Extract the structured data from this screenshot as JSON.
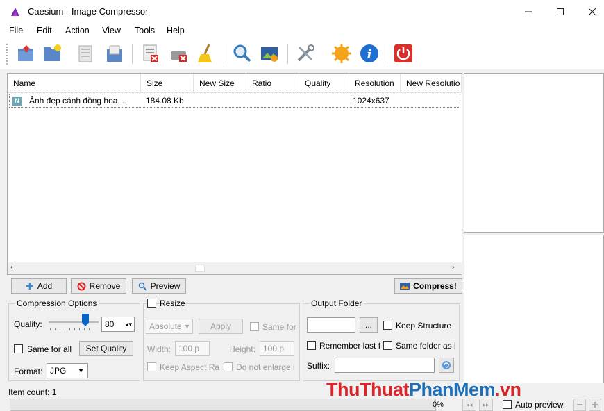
{
  "window": {
    "title": "Caesium - Image Compressor"
  },
  "menu": [
    "File",
    "Edit",
    "Action",
    "View",
    "Tools",
    "Help"
  ],
  "toolbar_icons": [
    "open-file-icon",
    "open-folder-icon",
    "save-list-icon",
    "import-list-icon",
    "remove-item-icon",
    "clear-list-icon",
    "clean-icon",
    "search-icon",
    "preview-icon",
    "settings-icon",
    "update-icon",
    "info-icon",
    "power-icon"
  ],
  "list": {
    "columns": [
      "Name",
      "Size",
      "New Size",
      "Ratio",
      "Quality",
      "Resolution",
      "New Resolutio"
    ],
    "rows": [
      {
        "icon_letter": "N",
        "name": "Ảnh đẹp cánh đồng hoa ...",
        "size": "184.08 Kb",
        "new_size": "",
        "ratio": "",
        "quality": "",
        "resolution": "1024x637",
        "new_resolution": ""
      }
    ]
  },
  "actions": {
    "add": "Add",
    "remove": "Remove",
    "preview": "Preview",
    "compress": "Compress!"
  },
  "compression": {
    "title": "Compression Options",
    "quality_label": "Quality:",
    "quality_value": "80",
    "same_for_all": "Same for all",
    "set_quality": "Set Quality",
    "format_label": "Format:",
    "format_value": "JPG"
  },
  "resize": {
    "title": "Resize",
    "mode": "Absolute",
    "apply": "Apply",
    "same_for": "Same for",
    "width_label": "Width:",
    "width_value": "100 p",
    "height_label": "Height:",
    "height_value": "100 p",
    "keep_aspect": "Keep Aspect Ra",
    "do_not_enlarge": "Do not enlarge i"
  },
  "output": {
    "title": "Output Folder",
    "browse": "...",
    "keep_structure": "Keep Structure",
    "remember_last": "Remember last f",
    "same_folder": "Same folder as i",
    "suffix_label": "Suffix:"
  },
  "status": {
    "item_count": "Item count: 1",
    "progress": "0%",
    "auto_preview": "Auto preview"
  },
  "watermark": {
    "part1": "ThuThuat",
    "part2": "PhanMem",
    "part3": ".vn"
  },
  "colors": {
    "accent": "#0a64c8",
    "watermark_red": "#d9262b",
    "watermark_blue": "#1e6fb5"
  }
}
